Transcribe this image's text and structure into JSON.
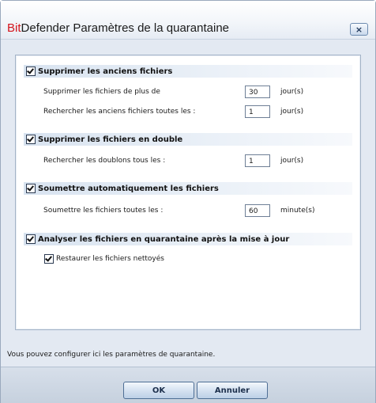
{
  "window": {
    "title_brand": "Bit",
    "title_rest": "Defender Paramètres de la quarantaine",
    "close_symbol": "×"
  },
  "sections": [
    {
      "label": "Supprimer les anciens fichiers",
      "checked": true,
      "rows": [
        {
          "label": "Supprimer les fichiers de plus de",
          "value": "30",
          "unit": "jour(s)"
        },
        {
          "label": "Rechercher les anciens fichiers toutes les :",
          "value": "1",
          "unit": "jour(s)"
        }
      ]
    },
    {
      "label": "Supprimer les fichiers en double",
      "checked": true,
      "rows": [
        {
          "label": "Rechercher les doublons tous les :",
          "value": "1",
          "unit": "jour(s)"
        }
      ]
    },
    {
      "label": "Soumettre automatiquement les fichiers",
      "checked": true,
      "rows": [
        {
          "label": "Soumettre les fichiers toutes les :",
          "value": "60",
          "unit": "minute(s)"
        }
      ]
    },
    {
      "label": "Analyser les fichiers en quarantaine après la mise à jour",
      "checked": true,
      "sub_checkbox": {
        "label": "Restaurer les fichiers nettoyés",
        "checked": true
      }
    }
  ],
  "info_text": "Vous pouvez configurer ici les paramètres de quarantaine.",
  "buttons": {
    "ok": "OK",
    "cancel": "Annuler"
  },
  "icons": {
    "checkbox": "checkmark-icon",
    "close": "close-icon"
  }
}
